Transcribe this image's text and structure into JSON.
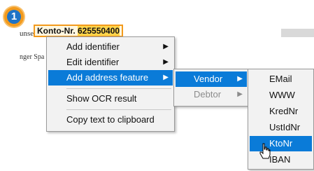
{
  "document": {
    "fragment_1": "unser",
    "fragment_2": "nger Spa",
    "highlight_label": "Konto-Nr.",
    "highlight_value": "625550400"
  },
  "step_badge": {
    "number": "1",
    "color": "#f39a1c",
    "inner_color": "#1e73c6"
  },
  "context_menu": {
    "items": [
      {
        "label": "Add identifier",
        "has_submenu": true
      },
      {
        "label": "Edit identifier",
        "has_submenu": true
      },
      {
        "label": "Add address feature",
        "has_submenu": true,
        "selected": true
      },
      {
        "label": "Show OCR result",
        "has_submenu": false
      },
      {
        "label": "Copy text to clipboard",
        "has_submenu": false
      }
    ]
  },
  "submenu_address_feature": {
    "items": [
      {
        "label": "Vendor",
        "has_submenu": true,
        "selected": true
      },
      {
        "label": "Debtor",
        "has_submenu": true,
        "disabled": true
      }
    ]
  },
  "submenu_vendor": {
    "items": [
      {
        "label": "EMail"
      },
      {
        "label": "WWW"
      },
      {
        "label": "KredNr"
      },
      {
        "label": "UstIdNr"
      },
      {
        "label": "KtoNr",
        "selected": true
      },
      {
        "label": "IBAN"
      }
    ]
  },
  "colors": {
    "selection": "#0a7bd8",
    "highlight_border": "#f39a1c",
    "highlight_fill": "#ffd44a"
  }
}
